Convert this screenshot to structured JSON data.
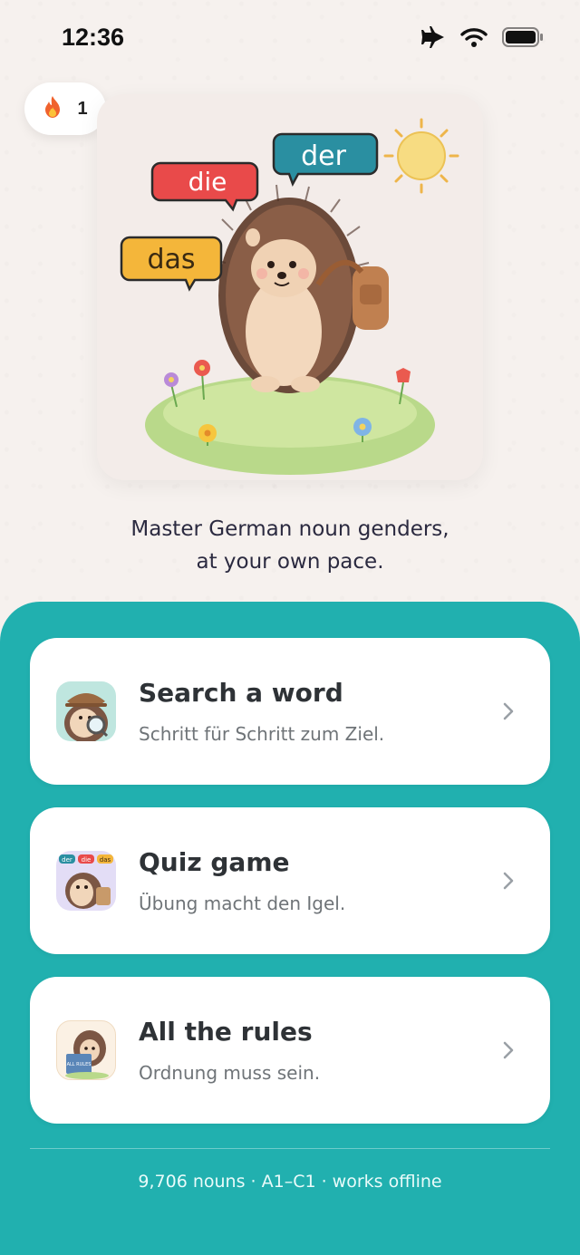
{
  "status": {
    "time": "12:36"
  },
  "streak": {
    "count": "1",
    "icon": "flame-icon"
  },
  "hero": {
    "bubbles": {
      "die": "die",
      "der": "der",
      "das": "das"
    }
  },
  "tagline": {
    "line1": "Master German noun genders,",
    "line2": "at your own pace."
  },
  "cards": [
    {
      "title": "Search a word",
      "subtitle": "Schritt für Schritt zum Ziel.",
      "icon": "hedgehog-detective-icon"
    },
    {
      "title": "Quiz game",
      "subtitle": "Übung macht den Igel.",
      "icon": "hedgehog-quiz-icon",
      "badges": [
        "der",
        "die",
        "das"
      ]
    },
    {
      "title": "All the rules",
      "subtitle": "Ordnung muss sein.",
      "icon": "hedgehog-reading-icon",
      "book_label": "ALL RULES"
    }
  ],
  "footer": {
    "text": "9,706 nouns · A1–C1 · works offline"
  },
  "colors": {
    "panel": "#21b0af",
    "der": "#2a8fa1",
    "die": "#e94a4a",
    "das": "#f4b63a"
  }
}
